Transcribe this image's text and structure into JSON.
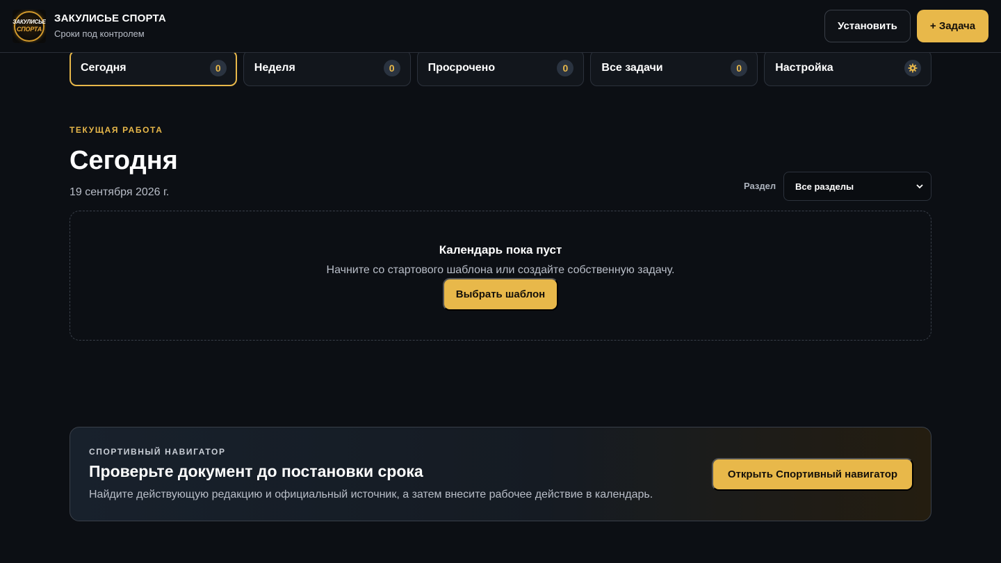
{
  "header": {
    "logo_text_top": "ЗАКУЛИСЬЕ",
    "logo_text_bottom": "СПОРТА",
    "title": "ЗАКУЛИСЬЕ СПОРТА",
    "subtitle": "Сроки под контролем",
    "install_label": "Установить",
    "add_task_label": "+ Задача"
  },
  "tabs": [
    {
      "label": "Сегодня",
      "count": "0",
      "active": true
    },
    {
      "label": "Неделя",
      "count": "0"
    },
    {
      "label": "Просрочено",
      "count": "0"
    },
    {
      "label": "Все задачи",
      "count": "0"
    },
    {
      "label": "Настройка",
      "icon": "gear-icon"
    }
  ],
  "main": {
    "eyebrow": "ТЕКУЩАЯ РАБОТА",
    "title": "Сегодня",
    "date": "19 сентября 2026 г.",
    "filter_label": "Раздел",
    "filter_value": "Все разделы"
  },
  "empty_state": {
    "title": "Календарь пока пуст",
    "text": "Начните со стартового шаблона или создайте собственную задачу.",
    "button_label": "Выбрать шаблон"
  },
  "navigator": {
    "eyebrow": "СПОРТИВНЫЙ НАВИГАТОР",
    "title": "Проверьте документ до постановки срока",
    "text": "Найдите действующую редакцию и официальный источник, а затем внесите рабочее действие в календарь.",
    "button_label": "Открыть Спортивный навигатор"
  },
  "colors": {
    "background": "#0c0f14",
    "accent": "#e8b84a",
    "card": "#12161c",
    "border": "#2c323c"
  }
}
